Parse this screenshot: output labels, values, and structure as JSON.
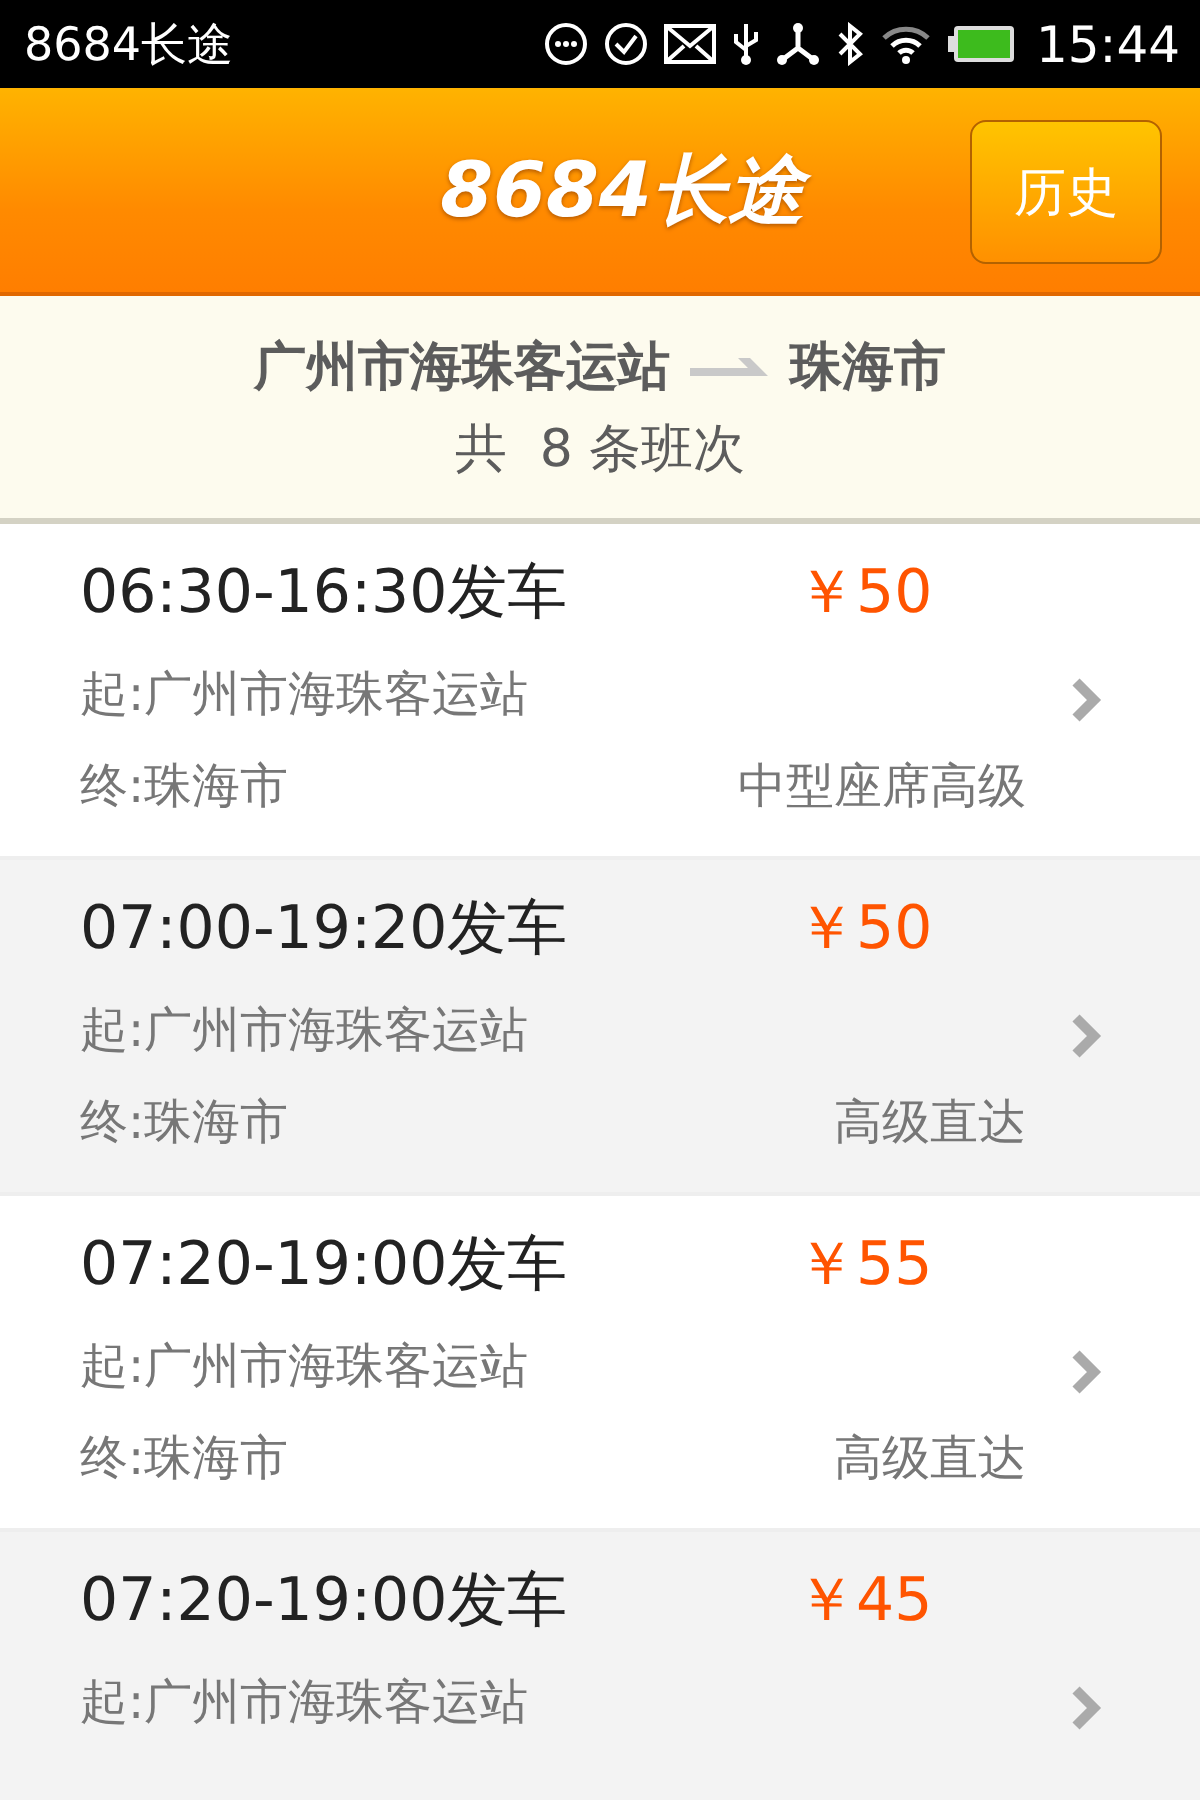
{
  "status_bar": {
    "app_name": "8684长途",
    "time": "15:44"
  },
  "header": {
    "logo": "8684长途",
    "history_button": "历史"
  },
  "route": {
    "from": "广州市海珠客运站",
    "to": "珠海市",
    "count_text": "共  8 条班次"
  },
  "trips": [
    {
      "time": "06:30-16:30发车",
      "price": "￥50",
      "start": "起:广州市海珠客运站",
      "end": "终:珠海市",
      "grade": "中型座席高级"
    },
    {
      "time": "07:00-19:20发车",
      "price": "￥50",
      "start": "起:广州市海珠客运站",
      "end": "终:珠海市",
      "grade": "高级直达"
    },
    {
      "time": "07:20-19:00发车",
      "price": "￥55",
      "start": "起:广州市海珠客运站",
      "end": "终:珠海市",
      "grade": "高级直达"
    },
    {
      "time": "07:20-19:00发车",
      "price": "￥45",
      "start": "起:广州市海珠客运站"
    }
  ]
}
